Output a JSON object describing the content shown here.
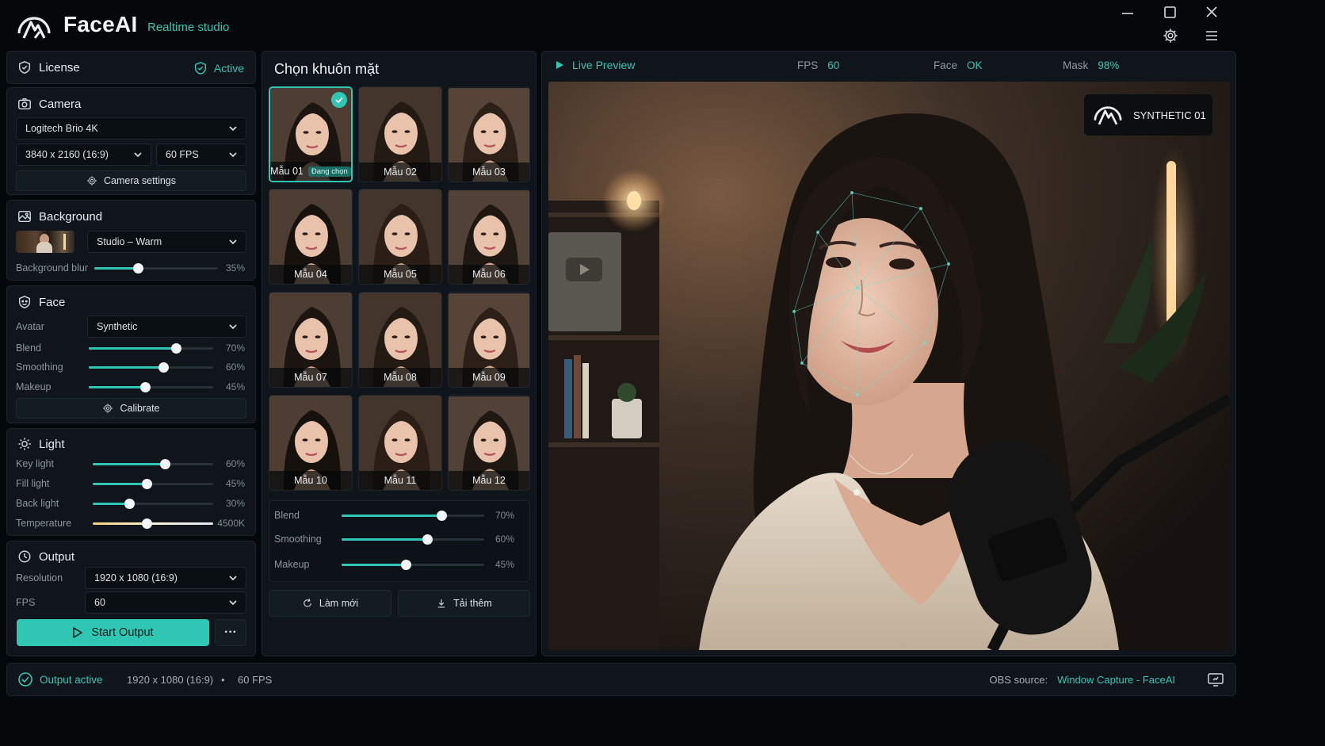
{
  "app": {
    "name": "FaceAI",
    "subtitle": "Realtime studio"
  },
  "window_controls": {
    "minimize": "minimize-icon",
    "maximize": "maximize-icon",
    "close": "close-icon"
  },
  "license": {
    "title": "License",
    "status": "Active"
  },
  "camera": {
    "title": "Camera",
    "device": "Logitech Brio 4K",
    "resolution": "3840 x 2160 (16:9)",
    "fps": "60 FPS",
    "settings_label": "Camera settings"
  },
  "background": {
    "title": "Background",
    "preset": "Studio – Warm",
    "blur_label": "Background blur",
    "blur_value": "35%",
    "blur": 0.35
  },
  "face": {
    "title": "Face",
    "avatar_label": "Avatar",
    "avatar": "Synthetic",
    "sliders": [
      {
        "label": "Blend",
        "value": "70%",
        "level": 0.7
      },
      {
        "label": "Smoothing",
        "value": "60%",
        "level": 0.6
      },
      {
        "label": "Makeup",
        "value": "45%",
        "level": 0.45
      }
    ],
    "calibrate_label": "Calibrate"
  },
  "light": {
    "title": "Light",
    "sliders": [
      {
        "label": "Key light",
        "value": "60%",
        "level": 0.6
      },
      {
        "label": "Fill light",
        "value": "45%",
        "level": 0.45
      },
      {
        "label": "Back light",
        "value": "30%",
        "level": 0.3
      },
      {
        "label": "Temperature",
        "value": "4500K",
        "level": 0.45
      }
    ]
  },
  "output": {
    "title": "Output",
    "resolution_label": "Resolution",
    "resolution": "1920 x 1080 (16:9)",
    "fps_label": "FPS",
    "fps": "60",
    "start_label": "Start Output",
    "more_label": "···"
  },
  "picker": {
    "title": "Chọn khuôn mặt",
    "selected_badge": "Đang chọn",
    "faces": [
      "Mẫu 01",
      "Mẫu 02",
      "Mẫu 03",
      "Mẫu 04",
      "Mẫu 05",
      "Mẫu 06",
      "Mẫu 07",
      "Mẫu 08",
      "Mẫu 09",
      "Mẫu 10",
      "Mẫu 11",
      "Mẫu 12"
    ],
    "sliders": [
      {
        "label": "Blend",
        "value": "70%",
        "level": 0.7
      },
      {
        "label": "Smoothing",
        "value": "60%",
        "level": 0.6
      },
      {
        "label": "Makeup",
        "value": "45%",
        "level": 0.45
      }
    ],
    "refresh_label": "Làm mới",
    "download_label": "Tải thêm"
  },
  "preview": {
    "title": "Live Preview",
    "fps_label": "FPS",
    "fps": "60",
    "face_label": "Face",
    "face": "OK",
    "mask_label": "Mask",
    "mask": "98%",
    "badge": "SYNTHETIC 01"
  },
  "status": {
    "output": "Output active",
    "resolution": "1920 x 1080 (16:9)",
    "separator": "•",
    "fps": "60 FPS",
    "obs_label": "OBS source:",
    "obs_value": "Window Capture - FaceAI"
  },
  "colors": {
    "accent": "#2fc6b4",
    "panel": "#0f151b",
    "bg": "#05080b"
  }
}
